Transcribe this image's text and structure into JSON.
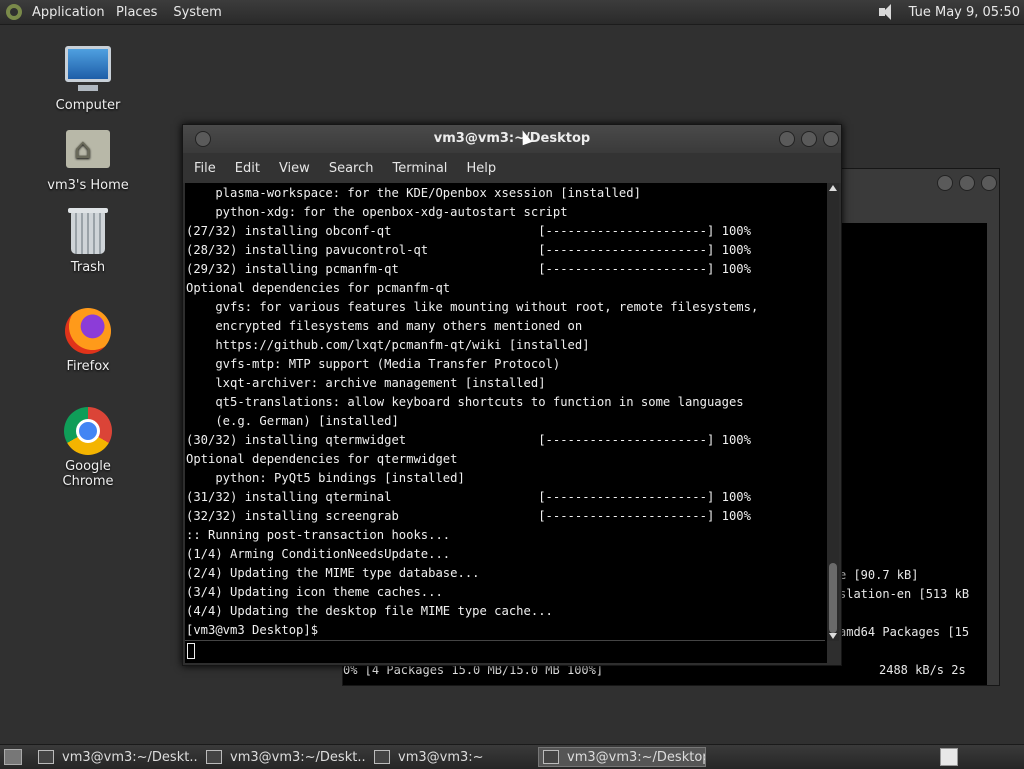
{
  "top_panel": {
    "applications": "Applications",
    "places": "Places",
    "system": "System",
    "clock": "Tue May 9, 05:50"
  },
  "desktop_icons": [
    {
      "label": "Computer",
      "icon": "computer-icon"
    },
    {
      "label": "vm3's Home",
      "icon": "home-folder-icon"
    },
    {
      "label": "Trash",
      "icon": "trash-icon"
    },
    {
      "label": "Firefox",
      "icon": "firefox-icon"
    },
    {
      "label": "Google Chrome",
      "icon": "chrome-icon"
    }
  ],
  "main_window": {
    "title": "vm3@vm3:~/Desktop",
    "menu": [
      "File",
      "Edit",
      "View",
      "Search",
      "Terminal",
      "Help"
    ],
    "lines": [
      "    plasma-workspace: for the KDE/Openbox xsession [installed]",
      "    python-xdg: for the openbox-xdg-autostart script",
      "(27/32) installing obconf-qt                    [----------------------] 100%",
      "(28/32) installing pavucontrol-qt               [----------------------] 100%",
      "(29/32) installing pcmanfm-qt                   [----------------------] 100%",
      "Optional dependencies for pcmanfm-qt",
      "    gvfs: for various features like mounting without root, remote filesystems,",
      "    encrypted filesystems and many others mentioned on",
      "    https://github.com/lxqt/pcmanfm-qt/wiki [installed]",
      "    gvfs-mtp: MTP support (Media Transfer Protocol)",
      "    lxqt-archiver: archive management [installed]",
      "    qt5-translations: allow keyboard shortcuts to function in some languages",
      "    (e.g. German) [installed]",
      "(30/32) installing qtermwidget                  [----------------------] 100%",
      "Optional dependencies for qtermwidget",
      "    python: PyQt5 bindings [installed]",
      "(31/32) installing qterminal                    [----------------------] 100%",
      "(32/32) installing screengrab                   [----------------------] 100%",
      ":: Running post-transaction hooks...",
      "(1/4) Arming ConditionNeedsUpdate...",
      "(2/4) Updating the MIME type database...",
      "(3/4) Updating icon theme caches...",
      "(4/4) Updating the desktop file MIME type cache...",
      "[vm3@vm3 Desktop]$"
    ]
  },
  "back_window": {
    "lines": [
      "e [90.7 kB]",
      "slation-en [513 kB",
      "amd64 Packages [15"
    ],
    "progress_line": "0% [4 Packages 15.0 MB/15.0 MB 100%]",
    "speed": "2488 kB/s 2s"
  },
  "taskbar": {
    "tasks": [
      {
        "label": "vm3@vm3:~/Deskt...",
        "active": false
      },
      {
        "label": "vm3@vm3:~/Deskt...",
        "active": false
      },
      {
        "label": "vm3@vm3:~",
        "active": false
      },
      {
        "label": "vm3@vm3:~/Desktop",
        "active": true
      }
    ]
  }
}
